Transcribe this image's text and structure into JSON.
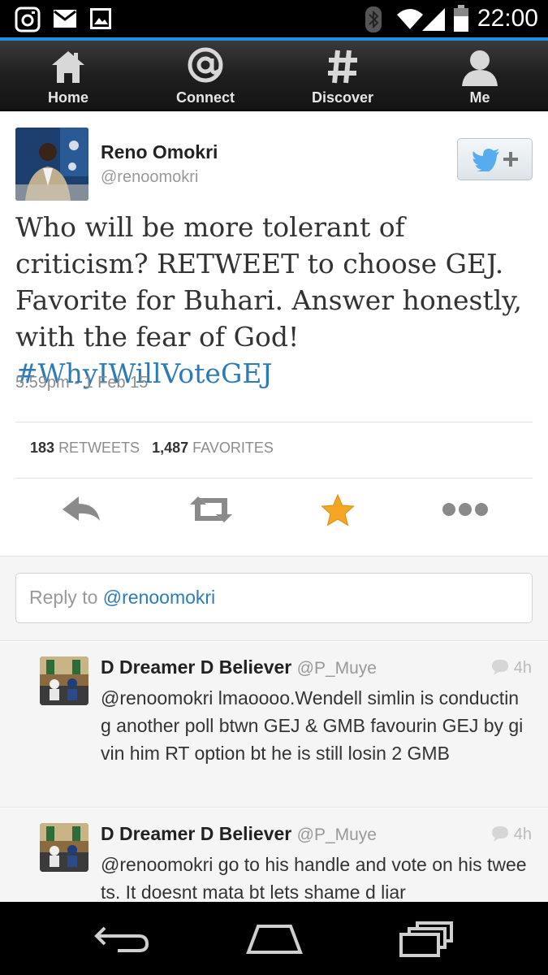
{
  "status_bar": {
    "time": "22:00"
  },
  "nav": {
    "items": [
      {
        "label": "Home",
        "icon": "home-icon"
      },
      {
        "label": "Connect",
        "icon": "at-icon"
      },
      {
        "label": "Discover",
        "icon": "hash-icon"
      },
      {
        "label": "Me",
        "icon": "person-icon"
      }
    ]
  },
  "tweet": {
    "author_name": "Reno Omokri",
    "author_handle": "@renoomokri",
    "text": "Who will be more tolerant of criticism? RETWEET to choose GEJ. Favorite for Buhari. Answer honestly, with the fear of God! ",
    "hashtag": "#WhyIWillVoteGEJ",
    "timestamp": "5:59pm - 1 Feb 15",
    "retweets_count": "183",
    "retweets_label": "RETWEETS",
    "favorites_count": "1,487",
    "favorites_label": "FAVORITES"
  },
  "reply_box": {
    "prefix": "Reply to ",
    "mention": "@renoomokri"
  },
  "replies": [
    {
      "name": "D Dreamer D Believer",
      "handle": "@P_Muye",
      "age": "4h",
      "text": "@renoomokri lmaoooo.Wendell simlin is conducting another poll btwn GEJ & GMB favourin GEJ by givin him RT option bt he is still losin 2 GMB"
    },
    {
      "name": "D Dreamer D Believer",
      "handle": "@P_Muye",
      "age": "4h",
      "text": "@renoomokri go to his handle and vote on his tweets. It doesnt mata bt lets shame d liar"
    }
  ],
  "colors": {
    "link": "#2b7bb9",
    "twitter_blue": "#55acee",
    "favorite_star": "#f5a623",
    "status_accent": "#1f8fe0"
  }
}
